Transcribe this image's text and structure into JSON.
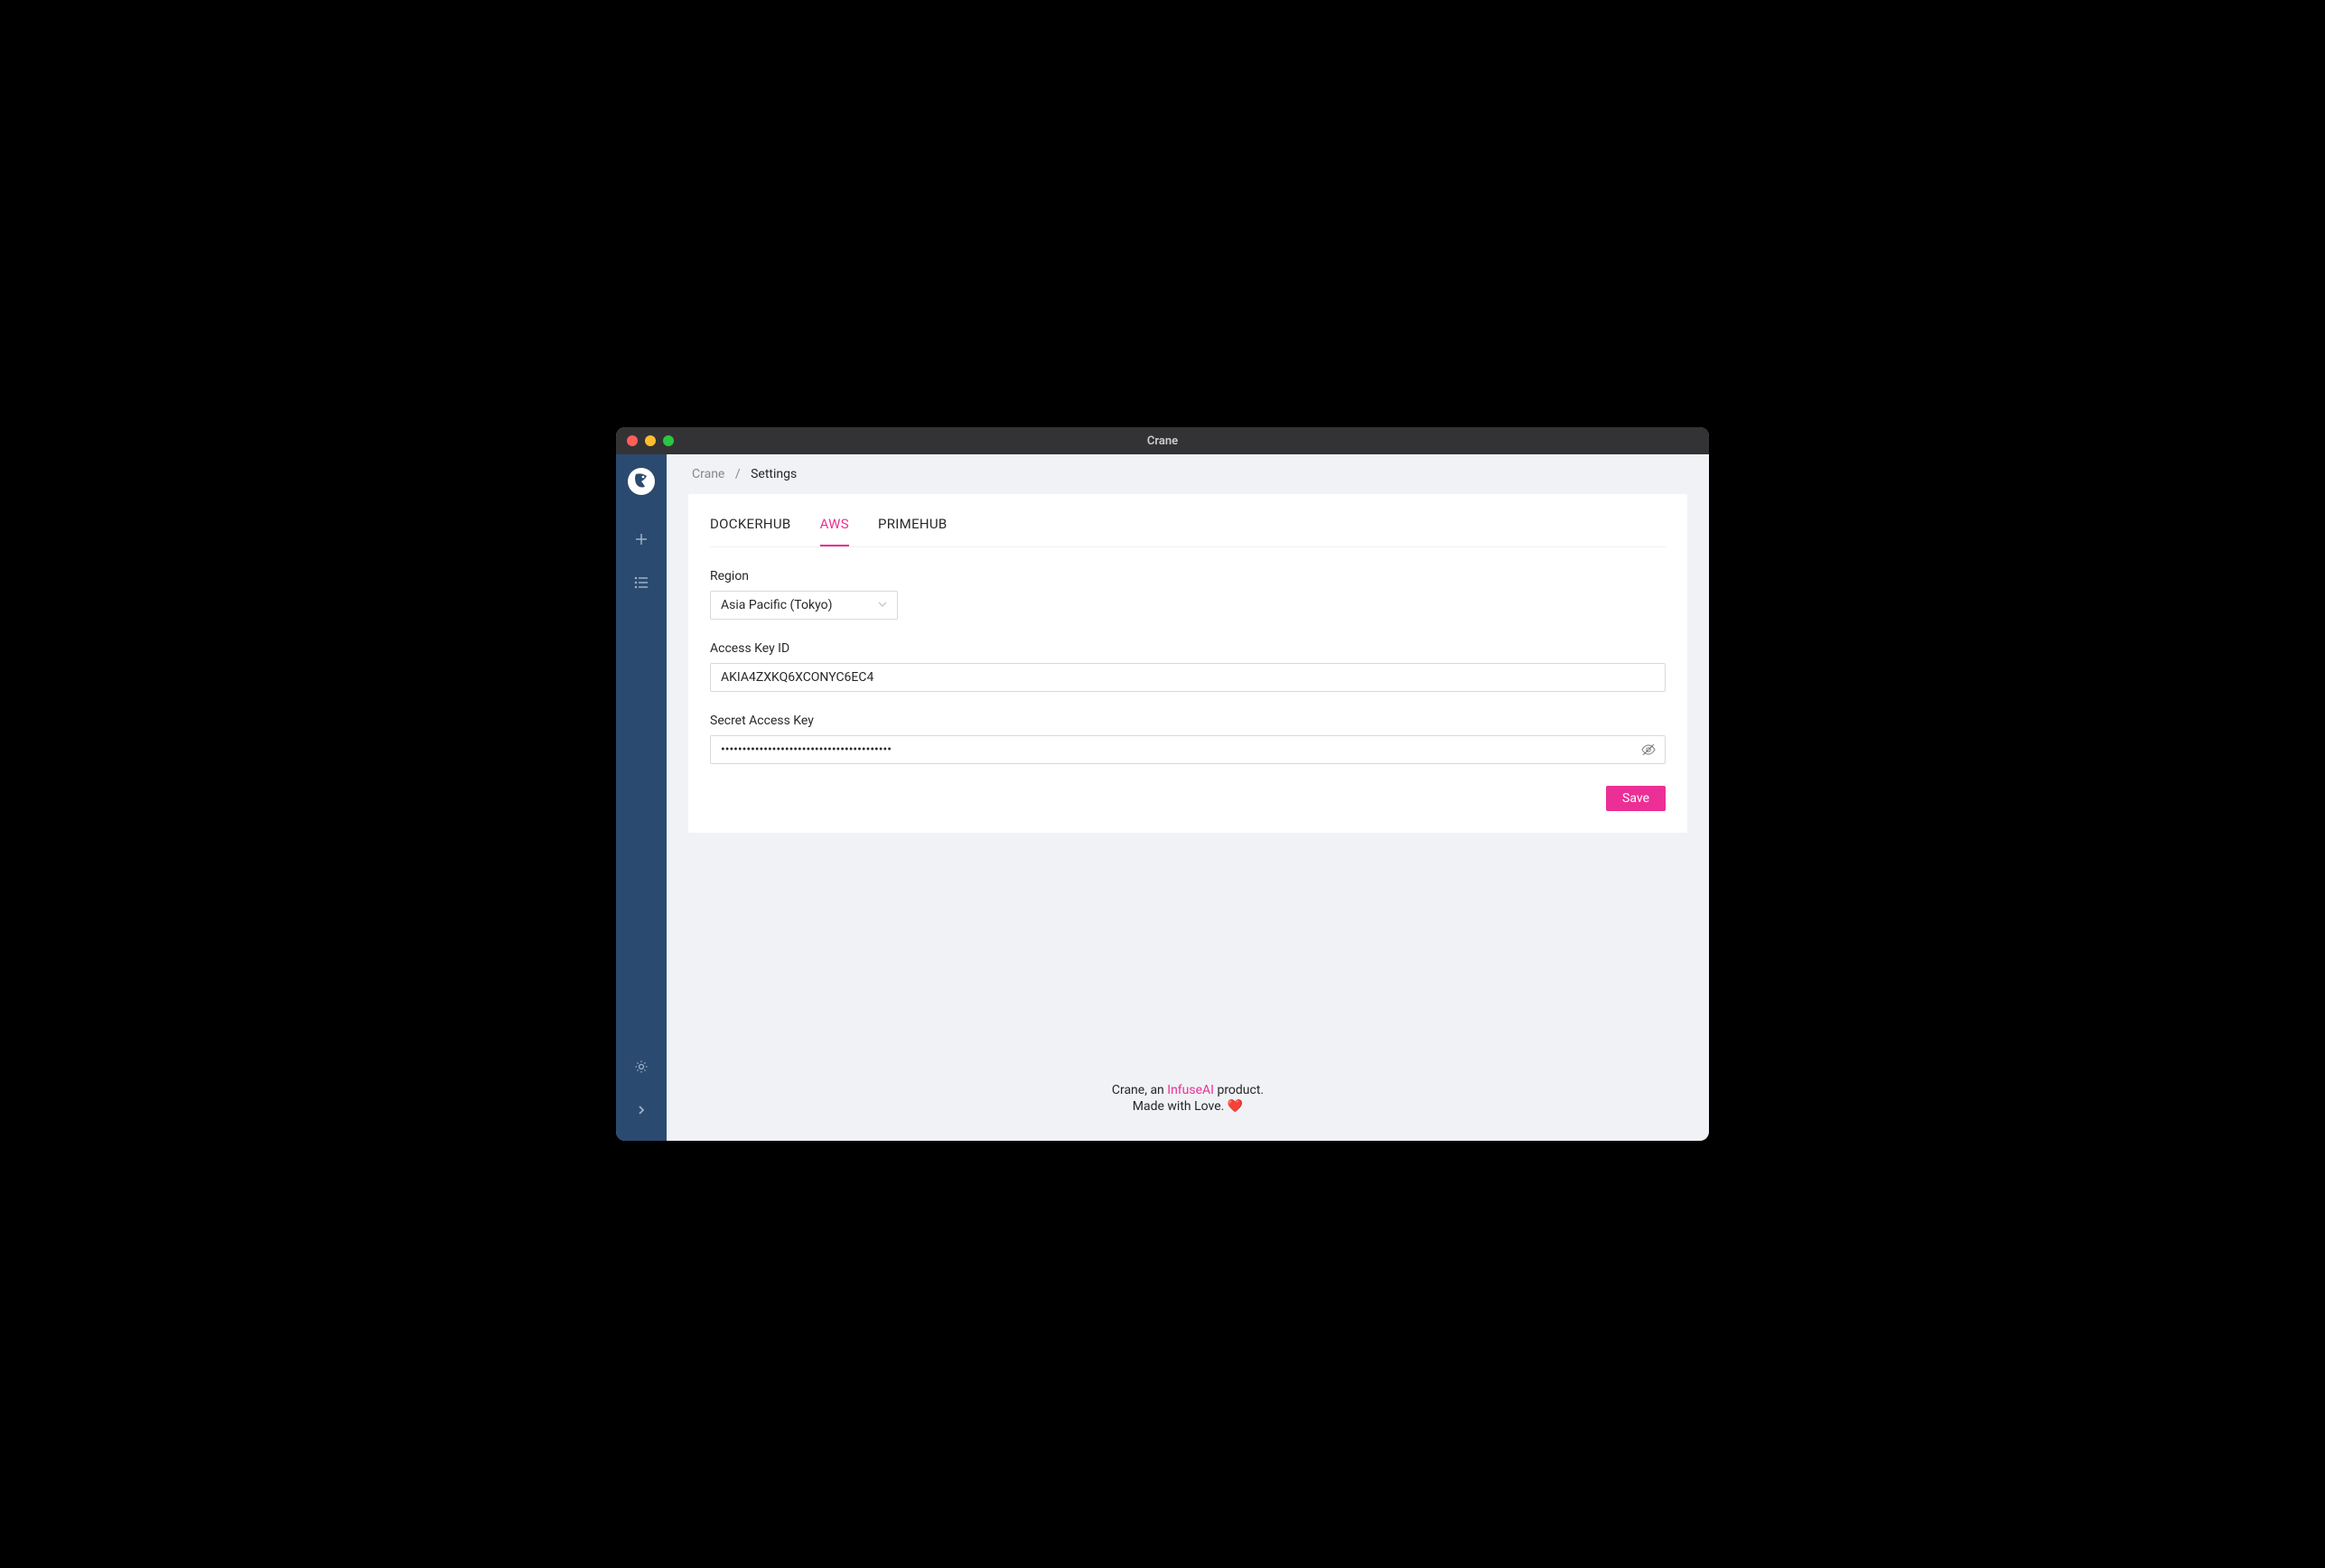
{
  "window": {
    "title": "Crane"
  },
  "breadcrumb": {
    "root": "Crane",
    "separator": "/",
    "current": "Settings"
  },
  "tabs": [
    {
      "label": "DOCKERHUB",
      "active": false
    },
    {
      "label": "AWS",
      "active": true
    },
    {
      "label": "PRIMEHUB",
      "active": false
    }
  ],
  "form": {
    "region": {
      "label": "Region",
      "value": "Asia Pacific (Tokyo)"
    },
    "access_key": {
      "label": "Access Key ID",
      "value": "AKIA4ZXKQ6XCONYC6EC4"
    },
    "secret_key": {
      "label": "Secret Access Key",
      "value": "••••••••••••••••••••••••••••••••••••••••"
    },
    "save_label": "Save"
  },
  "footer": {
    "prefix": "Crane, an ",
    "link": "InfuseAI",
    "suffix": " product.",
    "line2_prefix": "Made with Love. ",
    "heart": "❤️"
  },
  "colors": {
    "accent": "#eb2f96",
    "sidebar": "#2b4a6f"
  }
}
